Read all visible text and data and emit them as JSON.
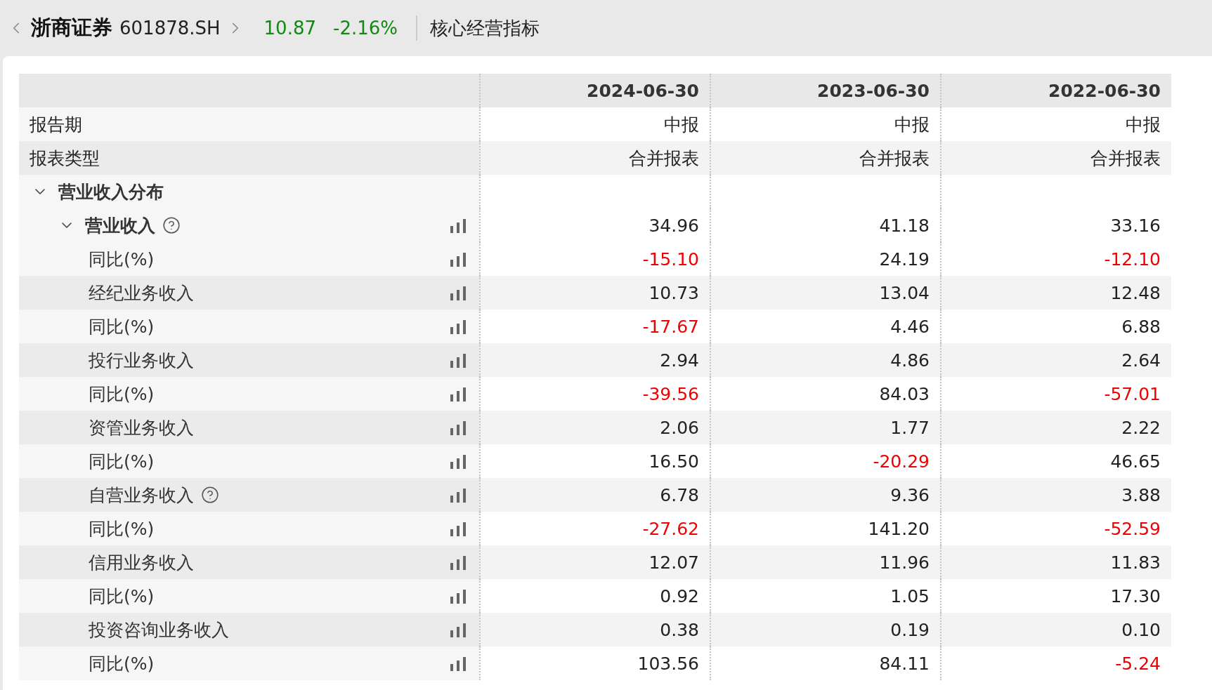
{
  "top_bar": {
    "name": "浙商证券",
    "code": "601878.SH",
    "price": "10.87",
    "change": "-2.16%",
    "page_title": "核心经营指标"
  },
  "table": {
    "columns": [
      "2024-06-30",
      "2023-06-30",
      "2022-06-30"
    ],
    "info_rows": [
      {
        "label": "报告期",
        "values": [
          "中报",
          "中报",
          "中报"
        ]
      },
      {
        "label": "报表类型",
        "values": [
          "合并报表",
          "合并报表",
          "合并报表"
        ]
      }
    ],
    "tree": [
      {
        "label": "营业收入分布",
        "expanded": true,
        "children": [
          {
            "label": "营业收入",
            "help": true,
            "expanded": true,
            "values": [
              {
                "text": "34.96",
                "negative": false
              },
              {
                "text": "41.18",
                "negative": false
              },
              {
                "text": "33.16",
                "negative": false
              }
            ],
            "children": [
              {
                "label": "同比(%)",
                "values": [
                  {
                    "text": "-15.10",
                    "negative": true
                  },
                  {
                    "text": "24.19",
                    "negative": false
                  },
                  {
                    "text": "-12.10",
                    "negative": true
                  }
                ]
              },
              {
                "label": "经纪业务收入",
                "values": [
                  {
                    "text": "10.73",
                    "negative": false
                  },
                  {
                    "text": "13.04",
                    "negative": false
                  },
                  {
                    "text": "12.48",
                    "negative": false
                  }
                ]
              },
              {
                "label": "同比(%)",
                "values": [
                  {
                    "text": "-17.67",
                    "negative": true
                  },
                  {
                    "text": "4.46",
                    "negative": false
                  },
                  {
                    "text": "6.88",
                    "negative": false
                  }
                ]
              },
              {
                "label": "投行业务收入",
                "values": [
                  {
                    "text": "2.94",
                    "negative": false
                  },
                  {
                    "text": "4.86",
                    "negative": false
                  },
                  {
                    "text": "2.64",
                    "negative": false
                  }
                ]
              },
              {
                "label": "同比(%)",
                "values": [
                  {
                    "text": "-39.56",
                    "negative": true
                  },
                  {
                    "text": "84.03",
                    "negative": false
                  },
                  {
                    "text": "-57.01",
                    "negative": true
                  }
                ]
              },
              {
                "label": "资管业务收入",
                "values": [
                  {
                    "text": "2.06",
                    "negative": false
                  },
                  {
                    "text": "1.77",
                    "negative": false
                  },
                  {
                    "text": "2.22",
                    "negative": false
                  }
                ]
              },
              {
                "label": "同比(%)",
                "values": [
                  {
                    "text": "16.50",
                    "negative": false
                  },
                  {
                    "text": "-20.29",
                    "negative": true
                  },
                  {
                    "text": "46.65",
                    "negative": false
                  }
                ]
              },
              {
                "label": "自营业务收入",
                "help": true,
                "values": [
                  {
                    "text": "6.78",
                    "negative": false
                  },
                  {
                    "text": "9.36",
                    "negative": false
                  },
                  {
                    "text": "3.88",
                    "negative": false
                  }
                ]
              },
              {
                "label": "同比(%)",
                "values": [
                  {
                    "text": "-27.62",
                    "negative": true
                  },
                  {
                    "text": "141.20",
                    "negative": false
                  },
                  {
                    "text": "-52.59",
                    "negative": true
                  }
                ]
              },
              {
                "label": "信用业务收入",
                "values": [
                  {
                    "text": "12.07",
                    "negative": false
                  },
                  {
                    "text": "11.96",
                    "negative": false
                  },
                  {
                    "text": "11.83",
                    "negative": false
                  }
                ]
              },
              {
                "label": "同比(%)",
                "values": [
                  {
                    "text": "0.92",
                    "negative": false
                  },
                  {
                    "text": "1.05",
                    "negative": false
                  },
                  {
                    "text": "17.30",
                    "negative": false
                  }
                ]
              },
              {
                "label": "投资咨询业务收入",
                "values": [
                  {
                    "text": "0.38",
                    "negative": false
                  },
                  {
                    "text": "0.19",
                    "negative": false
                  },
                  {
                    "text": "0.10",
                    "negative": false
                  }
                ]
              },
              {
                "label": "同比(%)",
                "values": [
                  {
                    "text": "103.56",
                    "negative": false
                  },
                  {
                    "text": "84.11",
                    "negative": false
                  },
                  {
                    "text": "-5.24",
                    "negative": true
                  }
                ]
              }
            ]
          }
        ]
      }
    ]
  }
}
